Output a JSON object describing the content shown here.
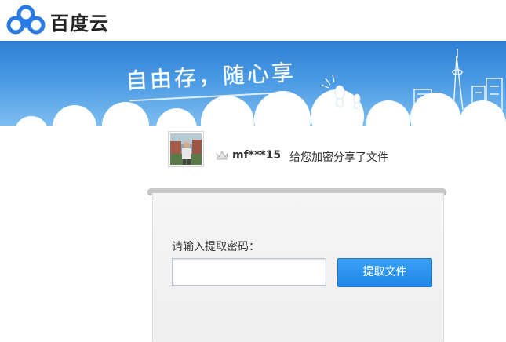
{
  "brand": {
    "name": "百度云",
    "icon": "baidu-cloud-logo-icon"
  },
  "banner": {
    "slogan": "自由存，随心享"
  },
  "share": {
    "avatar_icon": "user-avatar",
    "badge_icon": "crown-icon",
    "username": "mf***15",
    "message": "给您加密分享了文件"
  },
  "form": {
    "prompt": "请输入提取密码：",
    "password_value": "",
    "submit_label": "提取文件"
  },
  "colors": {
    "banner_top": "#2e7fd6",
    "banner_bottom": "#87c4f2",
    "button": "#2b8ff0",
    "logo_blue": "#2a7ae2"
  }
}
